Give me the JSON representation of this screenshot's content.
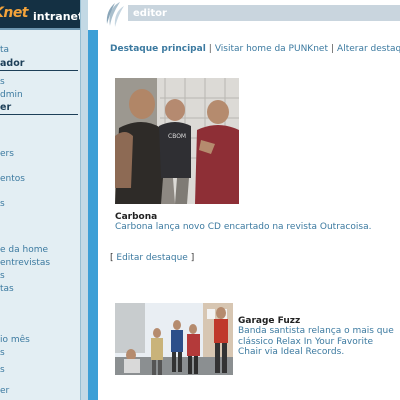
{
  "logo": {
    "brand_partial": "Knet",
    "suffix": "intranet"
  },
  "topbar": {
    "section": "editor"
  },
  "sidebar": {
    "items": [
      {
        "kind": "link",
        "label": "ta"
      },
      {
        "kind": "head",
        "label": "ador"
      },
      {
        "kind": "link",
        "label": "s"
      },
      {
        "kind": "link",
        "label": "dmin"
      },
      {
        "kind": "head",
        "label": "er"
      },
      {
        "kind": "link",
        "label": "ers"
      },
      {
        "kind": "link",
        "label": "entos"
      },
      {
        "kind": "link",
        "label": "s"
      },
      {
        "kind": "link",
        "label": "e da home"
      },
      {
        "kind": "link",
        "label": "entrevistas"
      },
      {
        "kind": "link",
        "label": "s"
      },
      {
        "kind": "link",
        "label": "tas"
      },
      {
        "kind": "link",
        "label": "io mês"
      },
      {
        "kind": "link",
        "label": "s"
      },
      {
        "kind": "link",
        "label": "s"
      },
      {
        "kind": "link",
        "label": "er"
      }
    ]
  },
  "nav": {
    "current": "Destaque principal",
    "separator": "|",
    "links": [
      "Visitar home da PUNKnet",
      "Alterar destaque"
    ]
  },
  "featured": {
    "title": "Carbona",
    "description": "Carbona lança novo CD encartado na revista Outracoisa."
  },
  "edit": {
    "open": "[",
    "label": "Editar destaque",
    "close": "]"
  },
  "secondary": {
    "title": "Garage Fuzz",
    "description": "Banda santista relança o mais que clássico Relax In Your Favorite Chair via Ideal Records."
  },
  "colors": {
    "header_dark": "#143043",
    "accent_blue": "#3d9fd6",
    "link": "#3c7aa0",
    "sidebar_bg": "#e3eef3"
  }
}
